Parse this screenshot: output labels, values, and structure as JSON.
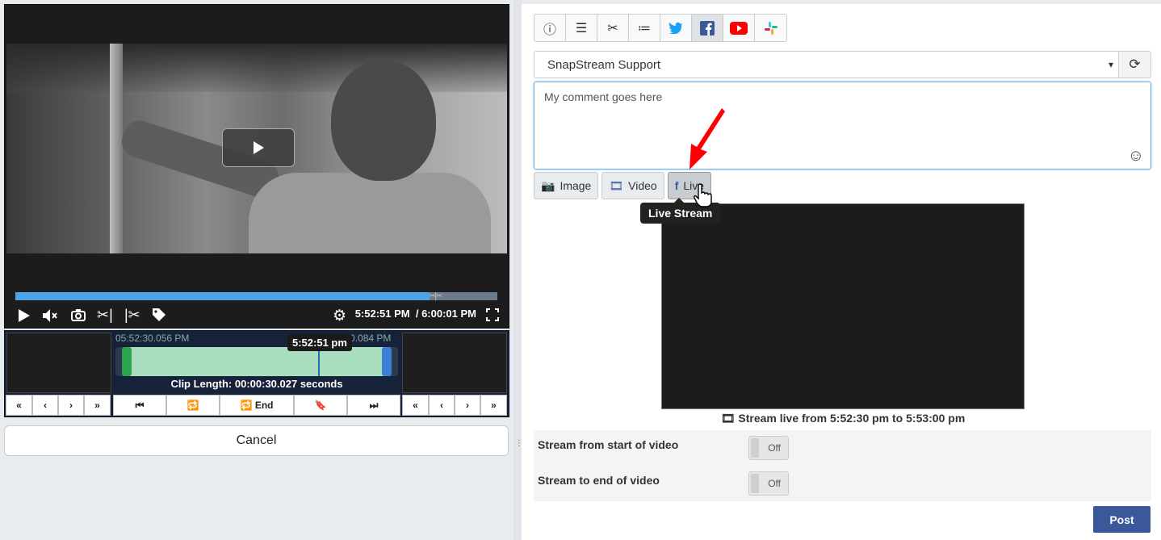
{
  "player": {
    "current_time": "5:52:51 PM",
    "total_time": "/ 6:00:01 PM",
    "progress_fraction": 0.86
  },
  "trimmer": {
    "start_label": "05:52:30.056 PM",
    "end_label": "05:53:00.084 PM",
    "cursor_time": "5:52:51 pm",
    "clip_length": "Clip Length: 00:00:30.027 seconds",
    "end_button": "End"
  },
  "cancel_label": "Cancel",
  "right": {
    "account": "SnapStream Support",
    "comment_placeholder": "My comment goes here",
    "media_buttons": {
      "image": "Image",
      "video": "Video",
      "live": "Live"
    },
    "tooltip": "Live Stream",
    "stream_label": "Stream live from 5:52:30 pm to 5:53:00 pm",
    "options": [
      {
        "label": "Stream from start of video",
        "state": "Off"
      },
      {
        "label": "Stream to end of video",
        "state": "Off"
      }
    ],
    "post_label": "Post"
  },
  "colors": {
    "facebook": "#3b5998",
    "twitter": "#1da1f2",
    "youtube": "#ff0000",
    "selection": "#a9dfbf",
    "arrow": "#ff0000"
  },
  "icons": [
    "info-icon",
    "text-icon",
    "scissors-icon",
    "list-icon",
    "twitter-icon",
    "facebook-icon",
    "youtube-icon",
    "slack-icon"
  ]
}
